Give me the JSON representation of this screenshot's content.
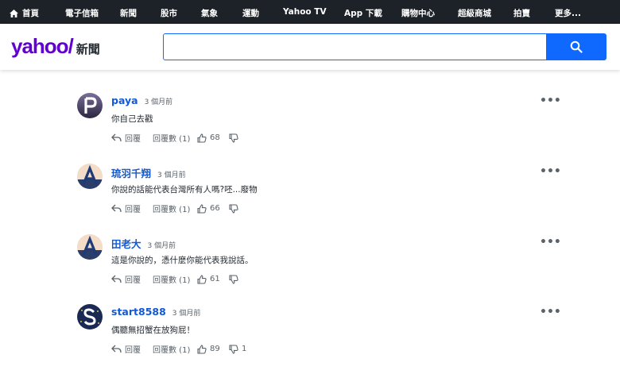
{
  "nav": {
    "items": [
      "首頁",
      "電子信箱",
      "新聞",
      "股市",
      "氣象",
      "運動",
      "Yahoo TV",
      "App 下載",
      "購物中心",
      "超級商城",
      "拍賣",
      "更多..."
    ]
  },
  "header": {
    "logo_text": "yahoo/",
    "section": "新聞",
    "search_value": ""
  },
  "comments": [
    {
      "name": "paya",
      "time": "3 個月前",
      "text": "你自己去戳",
      "reply_label": "回覆",
      "replies_label": "回覆數 (1)",
      "likes": "68",
      "dislikes": ""
    },
    {
      "name": "琉羽千翔",
      "time": "3 個月前",
      "text": "你說的話能代表台灣所有人嗎?呸...廢物",
      "reply_label": "回覆",
      "replies_label": "回覆數 (1)",
      "likes": "66",
      "dislikes": ""
    },
    {
      "name": "田老大",
      "time": "3 個月前",
      "text": "這是你說的，憑什麼你能代表我說話。",
      "reply_label": "回覆",
      "replies_label": "回覆數 (1)",
      "likes": "61",
      "dislikes": ""
    },
    {
      "name": "start8588",
      "time": "3 個月前",
      "text": "偶聽無招蟹在放狗屁！",
      "reply_label": "回覆",
      "replies_label": "回覆數 (1)",
      "likes": "89",
      "dislikes": "1"
    }
  ],
  "colors": {
    "nav_bg": "#1d2228",
    "brand": "#6001d2",
    "accent": "#0f69ff",
    "link": "#1259d4"
  }
}
